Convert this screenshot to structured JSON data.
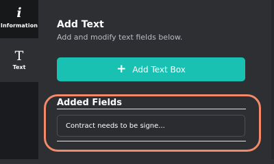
{
  "sidebar": {
    "items": [
      {
        "label": "Information",
        "icon": "info-icon",
        "glyph": "i"
      },
      {
        "label": "Text",
        "icon": "text-icon",
        "glyph": "T"
      }
    ]
  },
  "panel": {
    "title": "Add Text",
    "subtitle": "Add and modify text fields below.",
    "add_button_label": "Add Text Box",
    "add_button_glyph": "+"
  },
  "added_fields": {
    "title": "Added Fields",
    "fields": [
      {
        "text": "Contract needs to be signe..."
      }
    ]
  },
  "colors": {
    "accent": "#19c1b2",
    "highlight": "#f28a6b",
    "background": "#2d2f33",
    "sidebar": "#1a1b1e"
  }
}
